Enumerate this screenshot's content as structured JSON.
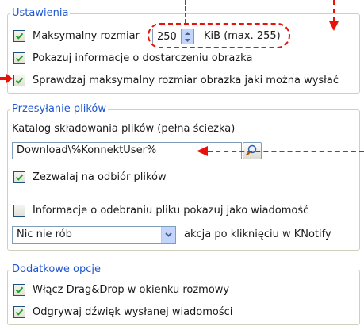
{
  "settings_group": {
    "title": "Ustawienia",
    "max_size": {
      "label": "Maksymalny rozmiar",
      "value": "250",
      "unit": "KiB (max. 255)",
      "checked": true
    },
    "show_delivery_info": {
      "label": "Pokazuj informacje o dostarczeniu obrazka",
      "checked": true
    },
    "check_max_size": {
      "label": "Sprawdzaj maksymalny rozmiar obrazka jaki można wysłać",
      "checked": true
    }
  },
  "file_transfer_group": {
    "title": "Przesyłanie plików",
    "dir_label": "Katalog składowania plików (pełna ścieżka)",
    "dir_value": "Download\\%KonnektUser%",
    "allow_receive": {
      "label": "Zezwalaj na odbiór plików",
      "checked": true
    },
    "info_as_message": {
      "label": "Informacje o odebraniu pliku pokazuj jako wiadomość",
      "checked": false
    },
    "action_select": {
      "value": "Nic nie rób"
    },
    "action_label": "akcja po kliknięciu w KNotify"
  },
  "extra_group": {
    "title": "Dodatkowe opcje",
    "drag_drop": {
      "label": "Włącz Drag&Drop w okienku rozmowy",
      "checked": true
    },
    "play_sound": {
      "label": "Odgrywaj dźwięk wysłanej wiadomości",
      "checked": true
    }
  },
  "colors": {
    "accent_title": "#1f57d1",
    "annotation_red": "#e8120a",
    "check_green": "#21a121"
  },
  "icons": {
    "checkmark": "check-icon",
    "browse": "search-icon",
    "dropdown": "chevron-down-icon",
    "spin": "spin-arrows-icon"
  }
}
